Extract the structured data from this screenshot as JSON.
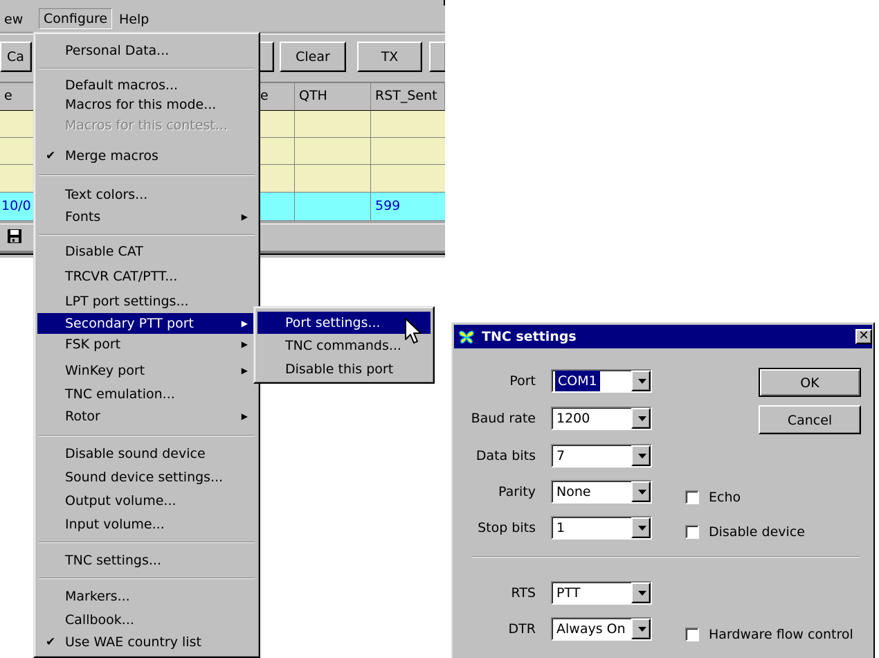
{
  "menubar": {
    "view_fragment": "ew",
    "configure": "Configure",
    "help": "Help"
  },
  "toolbar": {
    "call_fragment": "Ca",
    "clear": "Clear",
    "tx": "TX"
  },
  "log": {
    "headers": [
      "e",
      "e",
      "QTH",
      "RST_Sent"
    ],
    "rows": [
      {
        "c0": "",
        "qth": "",
        "rst": ""
      },
      {
        "c0": "",
        "qth": "",
        "rst": ""
      },
      {
        "c0": "",
        "qth": "",
        "rst": ""
      },
      {
        "c0": "10/0",
        "qth": "",
        "rst": "599"
      }
    ],
    "row_color": "#f0f0c0",
    "current_row_color": "#80ffff"
  },
  "configure_menu": {
    "items": [
      {
        "label": "Personal Data..."
      },
      {
        "label": "Default macros..."
      },
      {
        "label": "Macros for this mode..."
      },
      {
        "label": "Macros for this contest..."
      },
      {
        "label": "Merge macros",
        "checked": true
      },
      {
        "label": "Text colors..."
      },
      {
        "label": "Fonts"
      },
      {
        "label": "Disable CAT"
      },
      {
        "label": "TRCVR CAT/PTT..."
      },
      {
        "label": "LPT port settings..."
      },
      {
        "label": "Secondary PTT port"
      },
      {
        "label": "FSK port"
      },
      {
        "label": "WinKey port"
      },
      {
        "label": "TNC emulation..."
      },
      {
        "label": "Rotor"
      },
      {
        "label": "Disable sound device"
      },
      {
        "label": "Sound device settings..."
      },
      {
        "label": "Output volume..."
      },
      {
        "label": "Input volume..."
      },
      {
        "label": "TNC settings..."
      },
      {
        "label": "Markers..."
      },
      {
        "label": "Callbook..."
      },
      {
        "label": "Use WAE country list",
        "checked": true
      }
    ]
  },
  "submenu": {
    "items": [
      "Port settings...",
      "TNC commands...",
      "Disable this port"
    ]
  },
  "dialog": {
    "title": "TNC settings",
    "port_label": "Port",
    "port_value": "COM1",
    "baud_label": "Baud rate",
    "baud_value": "1200",
    "databits_label": "Data bits",
    "databits_value": "7",
    "parity_label": "Parity",
    "parity_value": "None",
    "stopbits_label": "Stop bits",
    "stopbits_value": "1",
    "rts_label": "RTS",
    "rts_value": "PTT",
    "dtr_label": "DTR",
    "dtr_value": "Always On",
    "ok": "OK",
    "cancel": "Cancel",
    "echo": "Echo",
    "disable_device": "Disable device",
    "hw_flow": "Hardware flow control"
  },
  "colors": {
    "menu_highlight": "#000080",
    "window_face": "#c0c0c0"
  }
}
